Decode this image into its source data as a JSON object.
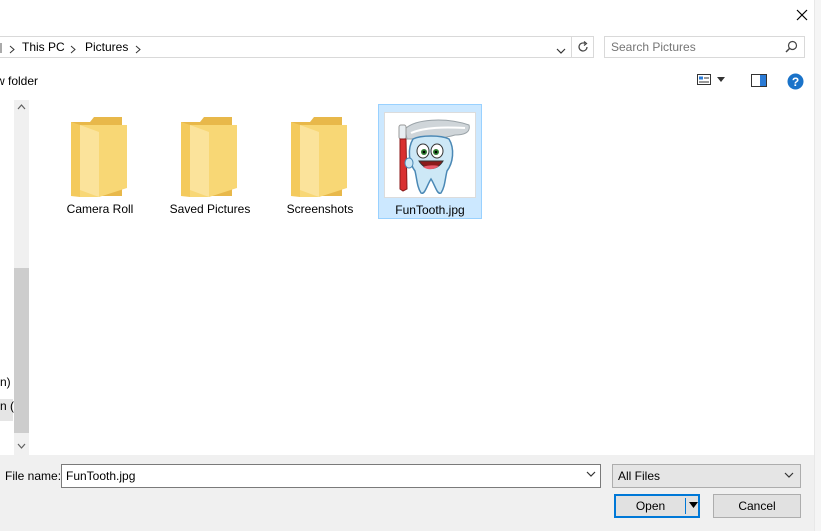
{
  "address": {
    "crumbs": [
      "This PC",
      "Pictures"
    ],
    "search_placeholder": "Search Pictures"
  },
  "toolbar": {
    "new_folder_label": "w folder"
  },
  "nav_fragments": [
    "n) (",
    "n ("
  ],
  "items": [
    {
      "label": "Camera Roll",
      "type": "folder"
    },
    {
      "label": "Saved Pictures",
      "type": "folder"
    },
    {
      "label": "Screenshots",
      "type": "folder"
    },
    {
      "label": "FunTooth.jpg",
      "type": "image",
      "selected": true
    }
  ],
  "footer": {
    "file_name_label": "File name:",
    "file_name_value": "FunTooth.jpg",
    "file_type_value": "All Files",
    "open_label": "Open",
    "cancel_label": "Cancel"
  },
  "colors": {
    "accent": "#0078d7",
    "selection_bg": "#cce8ff",
    "selection_border": "#99d1ff",
    "folder_yellow": "#f8d775"
  }
}
